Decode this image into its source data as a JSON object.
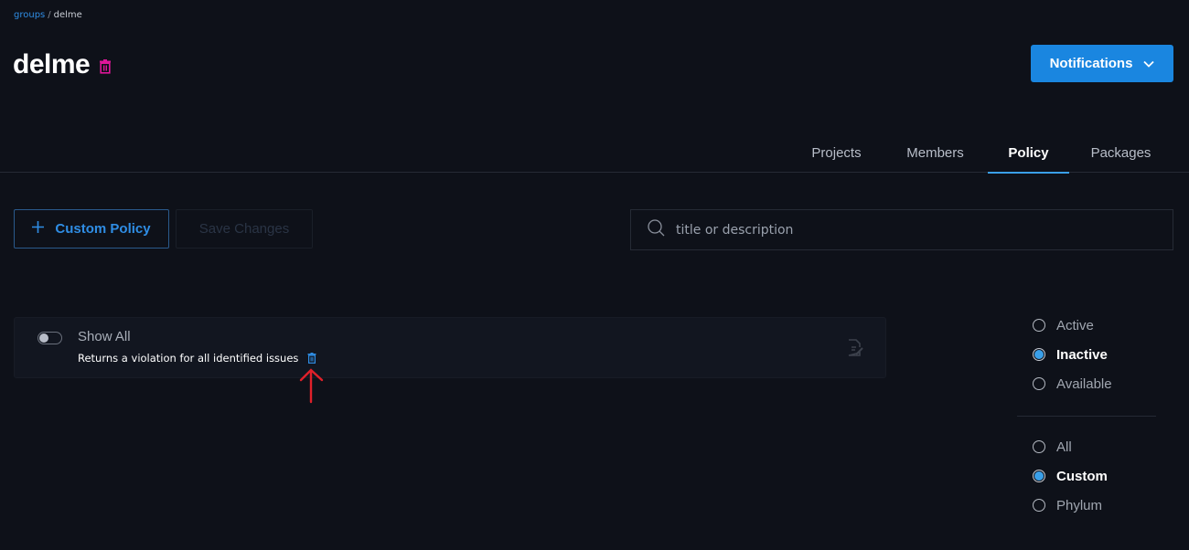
{
  "breadcrumb": {
    "parent": "groups",
    "separator": "/",
    "current": "delme"
  },
  "header": {
    "title": "delme",
    "delete_icon": "trash-icon",
    "notifications_label": "Notifications",
    "notifications_icon": "chevron-down-icon"
  },
  "tabs": [
    {
      "label": "Projects",
      "active": false
    },
    {
      "label": "Members",
      "active": false
    },
    {
      "label": "Policy",
      "active": true
    },
    {
      "label": "Packages",
      "active": false
    }
  ],
  "toolbar": {
    "custom_policy_label": "Custom Policy",
    "custom_policy_icon": "plus-icon",
    "save_label": "Save Changes",
    "search_placeholder": "title or description",
    "search_value": ""
  },
  "policies": [
    {
      "title": "Show All",
      "description": "Returns a violation for all identified issues",
      "enabled": false
    }
  ],
  "filters": {
    "status": [
      {
        "label": "Active",
        "checked": false
      },
      {
        "label": "Inactive",
        "checked": true
      },
      {
        "label": "Available",
        "checked": false
      }
    ],
    "source": [
      {
        "label": "All",
        "checked": false
      },
      {
        "label": "Custom",
        "checked": true
      },
      {
        "label": "Phylum",
        "checked": false
      }
    ]
  },
  "colors": {
    "accent": "#1a86e0",
    "danger": "#e0169a",
    "annotation": "#e0202a",
    "background": "#0e1119"
  }
}
